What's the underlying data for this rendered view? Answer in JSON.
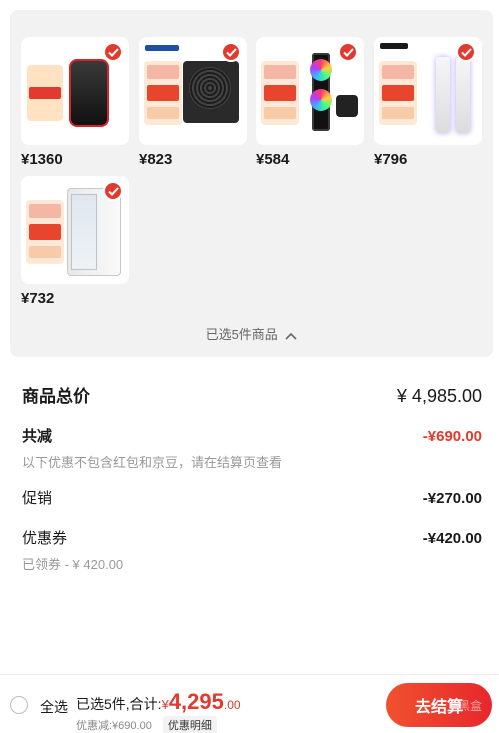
{
  "products": [
    {
      "name": "ssd",
      "price": "¥1360"
    },
    {
      "name": "power-supply",
      "price": "¥823"
    },
    {
      "name": "cpu-cooler",
      "price": "¥584"
    },
    {
      "name": "ram",
      "price": "¥796"
    },
    {
      "name": "pc-case",
      "price": "¥732"
    }
  ],
  "selected_toggle": {
    "label": "已选5件商品"
  },
  "summary": {
    "total_label": "商品总价",
    "total_value": "¥ 4,985.00",
    "reduce_label": "共减",
    "reduce_value": "-¥690.00",
    "reduce_note": "以下优惠不包含红包和京豆，请在结算页查看",
    "promo_label": "促销",
    "promo_value": "-¥270.00",
    "coupon_label": "优惠券",
    "coupon_value": "-¥420.00",
    "coupon_note": "已领券 - ¥ 420.00"
  },
  "bottom_bar": {
    "select_all": "全选",
    "selected_prefix": "已选5件,合计:",
    "currency": "¥",
    "amount": "4,295",
    "cents": ".00",
    "discount_text": "优惠减:¥690.00",
    "detail_link": "优惠明细",
    "checkout": "去结算",
    "checkout_overlay": "黑盒"
  },
  "colors": {
    "accent": "#e23a2e",
    "panel_bg": "#f2f2f2"
  }
}
